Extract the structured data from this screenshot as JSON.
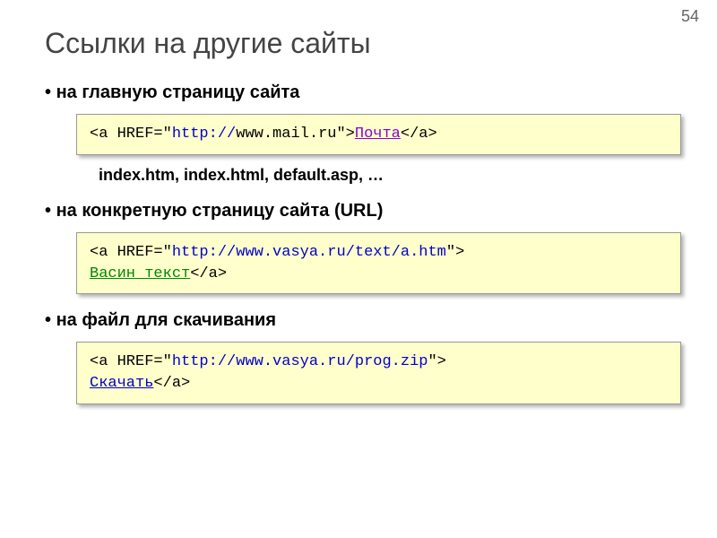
{
  "pageNumber": "54",
  "title": "Ссылки на другие сайты",
  "sections": {
    "bullet1": "на главную страницу сайта",
    "bullet2": "на конкретную страницу сайта (URL)",
    "bullet3": "на файл для скачивания",
    "subText": "index.htm, index.html, default.asp, …"
  },
  "code1": {
    "open": "<a HREF=\"",
    "prefix": "http://",
    "url": "www.mail.ru",
    "mid": "\">",
    "text": "Почта",
    "close": "</a>"
  },
  "code2": {
    "open": "<a HREF=\"",
    "url": "http://www.vasya.ru/text/a.htm",
    "mid": "\">",
    "text": "Васин текст",
    "close": "</a>"
  },
  "code3": {
    "open": "<a HREF=\"",
    "url": "http://www.vasya.ru/prog.zip",
    "mid": "\">",
    "text": "Скачать",
    "close": "</a>"
  }
}
